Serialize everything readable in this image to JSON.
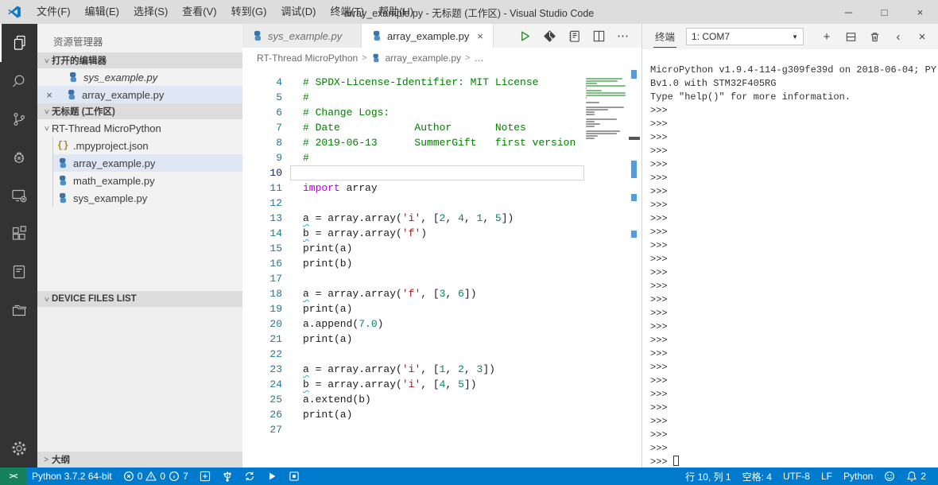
{
  "window": {
    "title": "array_example.py - 无标题 (工作区) - Visual Studio Code",
    "menus": [
      "文件(F)",
      "编辑(E)",
      "选择(S)",
      "查看(V)",
      "转到(G)",
      "调试(D)",
      "终端(T)",
      "帮助(H)"
    ]
  },
  "icons": {
    "close": "×",
    "minimize": "─",
    "maximize": "□",
    "dropdown": "▼",
    "more": "⋯",
    "chevron_left": "‹",
    "plus": "+",
    "breadcrumb_sep": ">",
    "chevron_expanded": ">",
    "remote": "><"
  },
  "sidebar": {
    "title": "资源管理器",
    "open_editors": {
      "header": "打开的编辑器",
      "items": [
        {
          "label": "sys_example.py"
        },
        {
          "label": "array_example.py"
        }
      ]
    },
    "workspace": {
      "header": "无标题 (工作区)",
      "folder": "RT-Thread MicroPython",
      "files": [
        {
          "label": ".mpyproject.json",
          "icon": "json-icon"
        },
        {
          "label": "array_example.py",
          "icon": "python-icon"
        },
        {
          "label": "math_example.py",
          "icon": "python-icon"
        },
        {
          "label": "sys_example.py",
          "icon": "python-icon"
        }
      ]
    },
    "device_files_header": "DEVICE FILES LIST",
    "outline_header": "大纲"
  },
  "editor": {
    "tabs": [
      {
        "label": "sys_example.py"
      },
      {
        "label": "array_example.py"
      }
    ],
    "breadcrumb": {
      "folder": "RT-Thread MicroPython",
      "file": "array_example.py",
      "more": "…"
    },
    "code": {
      "first_line": 4,
      "current_line": 10,
      "lines": [
        [
          [
            "c",
            "# SPDX-License-Identifier: MIT License"
          ]
        ],
        [
          [
            "c",
            "#"
          ]
        ],
        [
          [
            "c",
            "# Change Logs:"
          ]
        ],
        [
          [
            "c",
            "# Date            Author       Notes"
          ]
        ],
        [
          [
            "c",
            "# 2019-06-13      SummerGift   first version"
          ]
        ],
        [
          [
            "c",
            "#"
          ]
        ],
        [],
        [
          [
            "k",
            "import"
          ],
          [
            "p",
            " array"
          ]
        ],
        [],
        [
          [
            "v",
            "a"
          ],
          [
            "p",
            " = array.array("
          ],
          [
            "s",
            "'i'"
          ],
          [
            "p",
            ", ["
          ],
          [
            "n",
            "2"
          ],
          [
            "p",
            ", "
          ],
          [
            "n",
            "4"
          ],
          [
            "p",
            ", "
          ],
          [
            "n",
            "1"
          ],
          [
            "p",
            ", "
          ],
          [
            "n",
            "5"
          ],
          [
            "p",
            "])"
          ]
        ],
        [
          [
            "v",
            "b"
          ],
          [
            "p",
            " = array.array("
          ],
          [
            "s",
            "'f'"
          ],
          [
            "p",
            ")"
          ]
        ],
        [
          [
            "p",
            "print(a)"
          ]
        ],
        [
          [
            "p",
            "print(b)"
          ]
        ],
        [],
        [
          [
            "v",
            "a"
          ],
          [
            "p",
            " = array.array("
          ],
          [
            "s",
            "'f'"
          ],
          [
            "p",
            ", ["
          ],
          [
            "n",
            "3"
          ],
          [
            "p",
            ", "
          ],
          [
            "n",
            "6"
          ],
          [
            "p",
            "])"
          ]
        ],
        [
          [
            "p",
            "print(a)"
          ]
        ],
        [
          [
            "p",
            "a.append("
          ],
          [
            "n",
            "7.0"
          ],
          [
            "p",
            ")"
          ]
        ],
        [
          [
            "p",
            "print(a)"
          ]
        ],
        [],
        [
          [
            "v",
            "a"
          ],
          [
            "p",
            " = array.array("
          ],
          [
            "s",
            "'i'"
          ],
          [
            "p",
            ", ["
          ],
          [
            "n",
            "1"
          ],
          [
            "p",
            ", "
          ],
          [
            "n",
            "2"
          ],
          [
            "p",
            ", "
          ],
          [
            "n",
            "3"
          ],
          [
            "p",
            "])"
          ]
        ],
        [
          [
            "v",
            "b"
          ],
          [
            "p",
            " = array.array("
          ],
          [
            "s",
            "'i'"
          ],
          [
            "p",
            ", ["
          ],
          [
            "n",
            "4"
          ],
          [
            "p",
            ", "
          ],
          [
            "n",
            "5"
          ],
          [
            "p",
            "])"
          ]
        ],
        [
          [
            "p",
            "a.extend(b)"
          ]
        ],
        [
          [
            "p",
            "print(a)"
          ]
        ],
        []
      ]
    }
  },
  "terminal": {
    "tab_label": "终端",
    "selector_value": "1: COM7",
    "banner": [
      "MicroPython v1.9.4-114-g309fe39d on 2018-06-04; PY",
      "Bv1.0 with STM32F405RG",
      "Type \"help()\" for more information."
    ],
    "prompt": ">>>",
    "prompt_count": 26
  },
  "status_bar": {
    "interpreter": "Python 3.7.2 64-bit",
    "errors": "0",
    "warnings": "0",
    "infos": "7",
    "cursor_position": "行 10, 列 1",
    "indentation": "空格: 4",
    "encoding": "UTF-8",
    "eol": "LF",
    "language": "Python",
    "notifications": "2"
  },
  "colors": {
    "accent": "#007ACC",
    "remote_green": "#16825D",
    "comment": "#008000",
    "keyword": "#AF00DB",
    "string": "#A31515",
    "number": "#098658"
  }
}
